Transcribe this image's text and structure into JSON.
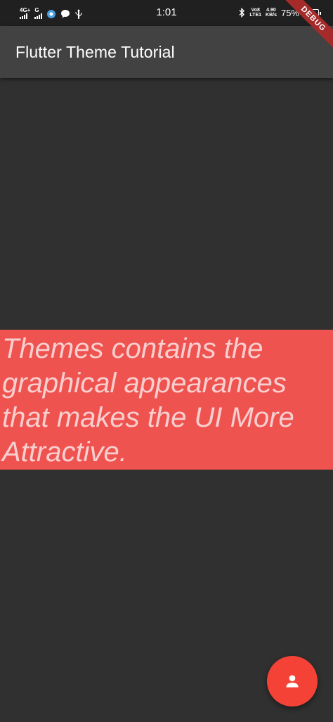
{
  "status_bar": {
    "net1_label": "4G+",
    "net2_label": "G",
    "time": "1:01",
    "volte": "Vo8",
    "lte": "LTE1",
    "speed_value": "4.90",
    "speed_unit": "KB/s",
    "battery_percent": "75%",
    "battery_level": 0.75
  },
  "debug_banner": "DEBUG",
  "app_bar": {
    "title": "Flutter Theme Tutorial",
    "background": "#424242"
  },
  "content": {
    "text": "Themes contains the graphical appearances that makes the UI More Attractive.",
    "box_color": "#ef5350",
    "text_color": "#f7cfcf"
  },
  "fab": {
    "icon": "person-icon",
    "color": "#f44336"
  },
  "page_background": "#303030"
}
